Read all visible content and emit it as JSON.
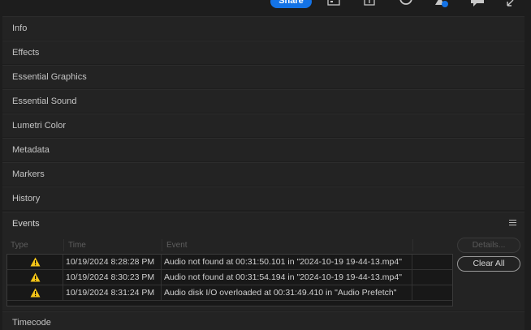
{
  "toolbar": {
    "share_label": "Share",
    "icons": [
      "quick-export-icon",
      "publish-icon",
      "progress-icon",
      "notifications-icon",
      "comments-icon",
      "minimize-icon"
    ],
    "accent": "#1473e6"
  },
  "panels": [
    {
      "label": "Info"
    },
    {
      "label": "Effects"
    },
    {
      "label": "Essential Graphics"
    },
    {
      "label": "Essential Sound"
    },
    {
      "label": "Lumetri Color"
    },
    {
      "label": "Metadata"
    },
    {
      "label": "Markers"
    },
    {
      "label": "History"
    }
  ],
  "events": {
    "label": "Events",
    "columns": {
      "type": "Type",
      "time": "Time",
      "event": "Event"
    },
    "rows": [
      {
        "type": "warning",
        "time": "10/19/2024 8:28:28 PM",
        "event": "Audio not found at 00:31:50.101 in \"2024-10-19 19-44-13.mp4\""
      },
      {
        "type": "warning",
        "time": "10/19/2024 8:30:23 PM",
        "event": "Audio not found at 00:31:54.194 in \"2024-10-19 19-44-13.mp4\""
      },
      {
        "type": "warning",
        "time": "10/19/2024 8:31:24 PM",
        "event": "Audio disk I/O overloaded at 00:31:49.410 in \"Audio Prefetch\""
      }
    ],
    "details_label": "Details...",
    "clear_all_label": "Clear All",
    "warning_color": "#f5c518"
  },
  "timecode": {
    "label": "Timecode"
  }
}
